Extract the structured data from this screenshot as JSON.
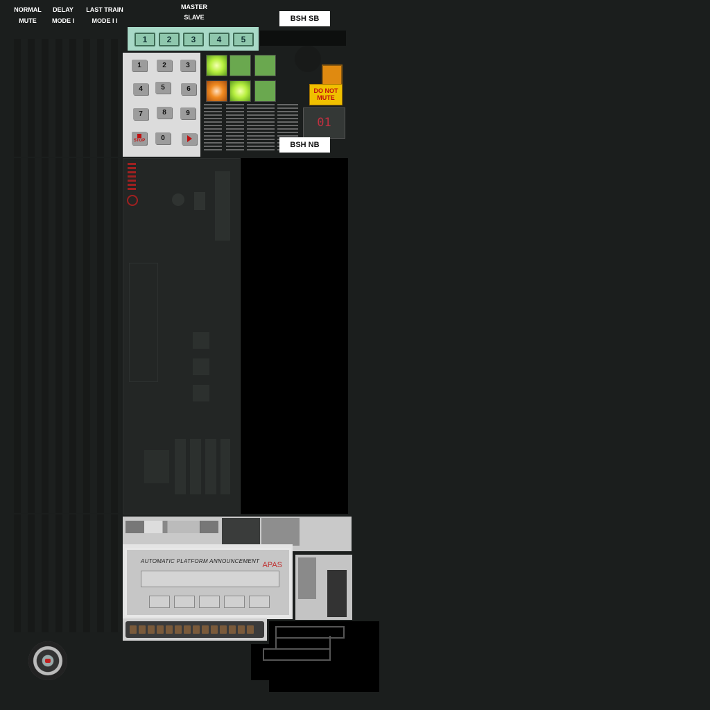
{
  "labels": {
    "normal": "NORMAL",
    "mute": "MUTE",
    "delay": "DELAY",
    "mode1": "MODE I",
    "last_train": "LAST TRAIN",
    "mode2": "MODE I I",
    "master": "MASTER",
    "slave": "SLAVE"
  },
  "bsh_sb": "BSH SB",
  "bsh_nb": "BSH NB",
  "slots": [
    "1",
    "2",
    "3",
    "4",
    "5"
  ],
  "keypad": [
    "1",
    "2",
    "3",
    "4",
    "5",
    "6",
    "7",
    "8",
    "9",
    "STOP",
    "0"
  ],
  "do_not_mute": "DO NOT MUTE",
  "counter": "01",
  "apas": {
    "title": "AUTOMATIC PLATFORM ANNOUNCEMENT",
    "brand": "APAS"
  },
  "colors": {
    "background": "#1b1e1d",
    "lamp_green_on": "#b8f040",
    "lamp_green_off": "#6aa84f",
    "lamp_orange": "#f08a20",
    "warning_yellow": "#f0c000",
    "warning_red": "#c01010"
  },
  "icons": {
    "play": "play-icon",
    "stop": "stop-icon",
    "badge": "emblem-badge-icon"
  }
}
